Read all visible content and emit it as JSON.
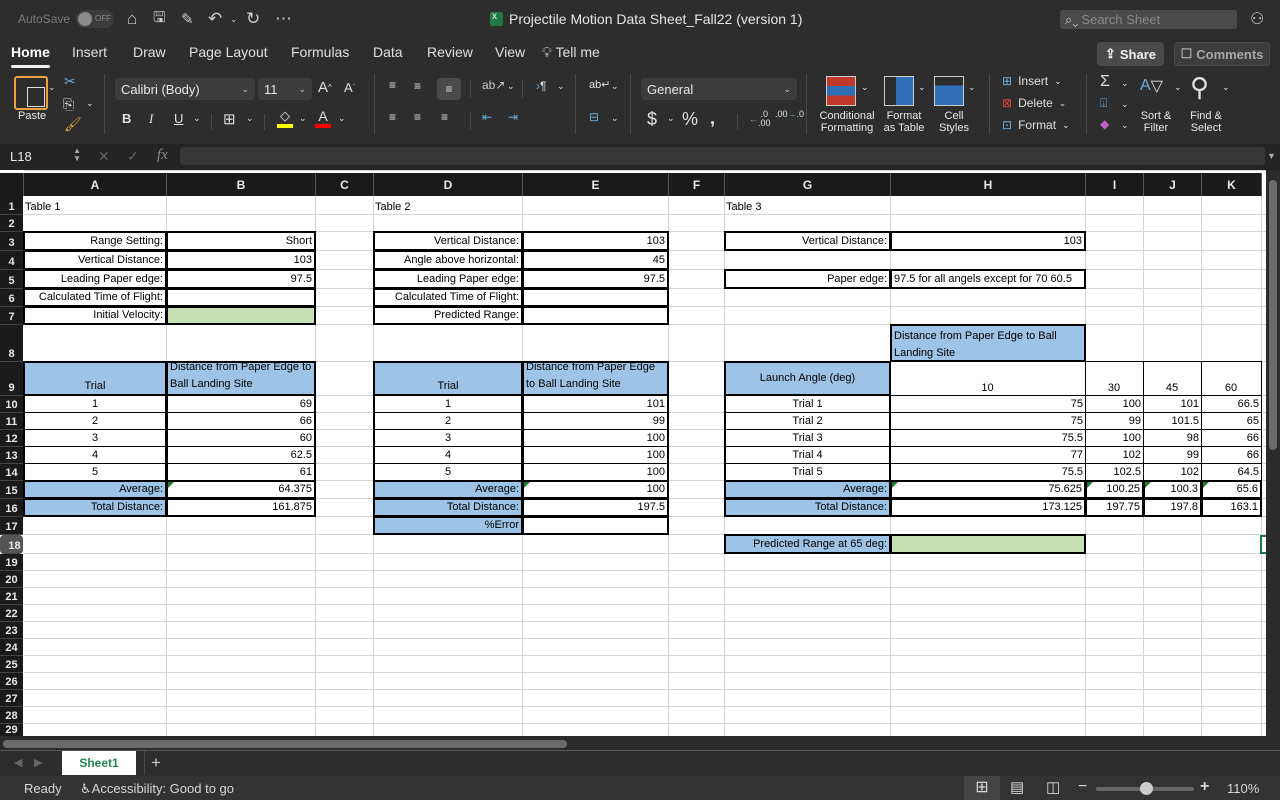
{
  "titlebar": {
    "autosave_label": "AutoSave",
    "autosave_state": "OFF",
    "doc_title": "Projectile Motion Data Sheet_Fall22 (version 1)",
    "search_placeholder": "Search Sheet",
    "icons": [
      "home-icon",
      "save-icon",
      "save-as-icon",
      "undo-icon",
      "redo-icon",
      "more-icon",
      "collaborate-icon"
    ]
  },
  "ribbon_tabs": [
    "Home",
    "Insert",
    "Draw",
    "Page Layout",
    "Formulas",
    "Data",
    "Review",
    "View",
    "Tell me"
  ],
  "active_tab": "Home",
  "share_label": "Share",
  "comments_label": "Comments",
  "ribbon": {
    "paste_label": "Paste",
    "font_name": "Calibri (Body)",
    "font_size": "11",
    "number_format": "General",
    "conditional_formatting": "Conditional Formatting",
    "cf_line1": "Conditional",
    "cf_line2": "Formatting",
    "fat_line1": "Format",
    "fat_line2": "as Table",
    "cs_line1": "Cell",
    "cs_line2": "Styles",
    "insert_label": "Insert",
    "delete_label": "Delete",
    "format_label": "Format",
    "sort_line1": "Sort &",
    "sort_line2": "Filter",
    "find_line1": "Find &",
    "find_line2": "Select",
    "bold": "B",
    "italic": "I",
    "underline": "U",
    "fill_color": "#ffff00",
    "font_color": "#ff0000"
  },
  "formula_bar": {
    "name_box": "L18",
    "fx_label": "fx",
    "formula": ""
  },
  "columns": [
    "A",
    "B",
    "C",
    "D",
    "E",
    "F",
    "G",
    "H",
    "I",
    "J",
    "K"
  ],
  "rows": [
    "1",
    "2",
    "3",
    "4",
    "5",
    "6",
    "7",
    "8",
    "9",
    "10",
    "11",
    "12",
    "13",
    "14",
    "15",
    "16",
    "17",
    "18",
    "19",
    "20",
    "21",
    "22",
    "23",
    "24",
    "25",
    "26",
    "27",
    "28",
    "29"
  ],
  "selected_row": "18",
  "table1": {
    "title": "Table 1",
    "params": [
      {
        "label": "Range Setting:",
        "value": "Short"
      },
      {
        "label": "Vertical Distance:",
        "value": "103"
      },
      {
        "label": "Leading Paper edge:",
        "value": "97.5"
      },
      {
        "label": "Calculated Time of Flight:",
        "value": ""
      },
      {
        "label": "Initial Velocity:",
        "value": ""
      }
    ],
    "header_trial": "Trial",
    "header_distance": "Distance from Paper Edge to Ball Landing Site",
    "trials": [
      {
        "trial": "1",
        "distance": "69"
      },
      {
        "trial": "2",
        "distance": "66"
      },
      {
        "trial": "3",
        "distance": "60"
      },
      {
        "trial": "4",
        "distance": "62.5"
      },
      {
        "trial": "5",
        "distance": "61"
      }
    ],
    "average_label": "Average:",
    "average": "64.375",
    "total_label": "Total Distance:",
    "total": "161.875"
  },
  "table2": {
    "title": "Table 2",
    "params": [
      {
        "label": "Vertical Distance:",
        "value": "103"
      },
      {
        "label": "Angle above horizontal:",
        "value": "45"
      },
      {
        "label": "Leading Paper edge:",
        "value": "97.5"
      },
      {
        "label": "Calculated Time of Flight:",
        "value": ""
      },
      {
        "label": "Predicted Range:",
        "value": ""
      }
    ],
    "header_trial": "Trial",
    "header_distance": "Distance from Paper Edge to Ball Landing Site",
    "trials": [
      {
        "trial": "1",
        "distance": "101"
      },
      {
        "trial": "2",
        "distance": "99"
      },
      {
        "trial": "3",
        "distance": "100"
      },
      {
        "trial": "4",
        "distance": "100"
      },
      {
        "trial": "5",
        "distance": "100"
      }
    ],
    "average_label": "Average:",
    "average": "100",
    "total_label": "Total Distance:",
    "total": "197.5",
    "error_label": "%Error",
    "error": ""
  },
  "table3": {
    "title": "Table 3",
    "vertical_label": "Vertical Distance:",
    "vertical_value": "103",
    "paper_label": "Paper edge:",
    "paper_value": "97.5 for all angels except for 70  60.5",
    "distance_header": "Distance from Paper Edge to Ball Landing Site",
    "angle_header": "Launch Angle (deg)",
    "angles": [
      "10",
      "30",
      "45",
      "60"
    ],
    "trials": [
      {
        "label": "Trial 1",
        "values": [
          "75",
          "100",
          "101",
          "66.5"
        ]
      },
      {
        "label": "Trial 2",
        "values": [
          "75",
          "99",
          "101.5",
          "65"
        ]
      },
      {
        "label": "Trial 3",
        "values": [
          "75.5",
          "100",
          "98",
          "66"
        ]
      },
      {
        "label": "Trial 4",
        "values": [
          "77",
          "102",
          "99",
          "66"
        ]
      },
      {
        "label": "Trial 5",
        "values": [
          "75.5",
          "102.5",
          "102",
          "64.5"
        ]
      }
    ],
    "average_label": "Average:",
    "averages": [
      "75.625",
      "100.25",
      "100.3",
      "65.6"
    ],
    "total_label": "Total Distance:",
    "totals": [
      "173.125",
      "197.75",
      "197.8",
      "163.1"
    ],
    "predicted_label": "Predicted Range at 65 deg:",
    "predicted_value": ""
  },
  "sheet_tabs": [
    "Sheet1"
  ],
  "active_sheet": "Sheet1",
  "status": {
    "ready": "Ready",
    "accessibility": "Accessibility: Good to go",
    "zoom": "110%",
    "zoom_level_percent": 110
  },
  "colors": {
    "header_blue": "#9dc3e6",
    "input_green": "#c6e0b4",
    "sheet_tab_green": "#1d8a4e"
  }
}
